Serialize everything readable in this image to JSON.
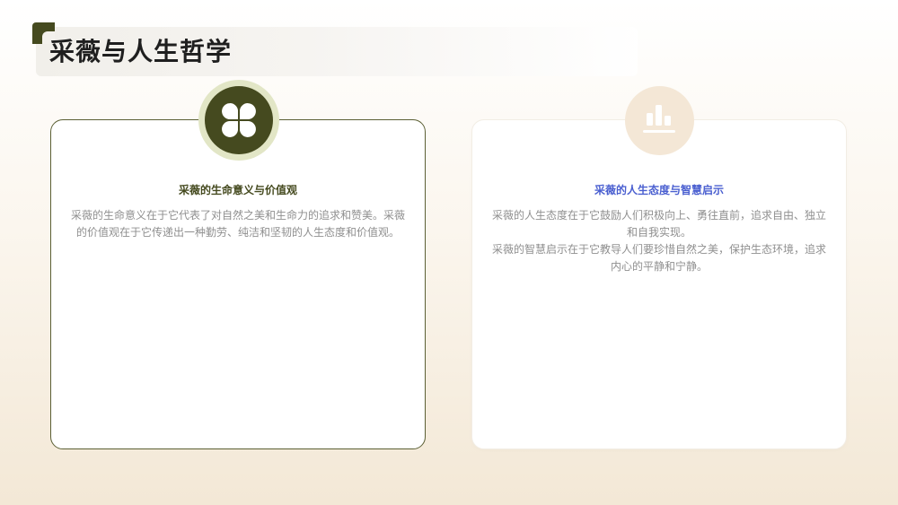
{
  "slide": {
    "title": "采薇与人生哲学"
  },
  "cards": [
    {
      "heading": "采薇的生命意义与价值观",
      "paragraphs": [
        "采薇的生命意义在于它代表了对自然之美和生命力的追求和赞美。采薇的价值观在于它传递出一种勤劳、纯洁和坚韧的人生态度和价值观。"
      ],
      "icon": "clover-icon"
    },
    {
      "heading": "采薇的人生态度与智慧启示",
      "paragraphs": [
        "采薇的人生态度在于它鼓励人们积极向上、勇往直前，追求自由、独立和自我实现。",
        "采薇的智慧启示在于它教导人们要珍惜自然之美，保护生态环境，追求内心的平静和宁静。"
      ],
      "icon": "bar-chart-icon"
    }
  ],
  "colors": {
    "accent_dark": "#454a1f",
    "accent_light": "#e2e6c6",
    "heading_blue": "#4a5fd0",
    "badge_beige": "#f4e7d6",
    "body_text": "#8f8f8f"
  }
}
